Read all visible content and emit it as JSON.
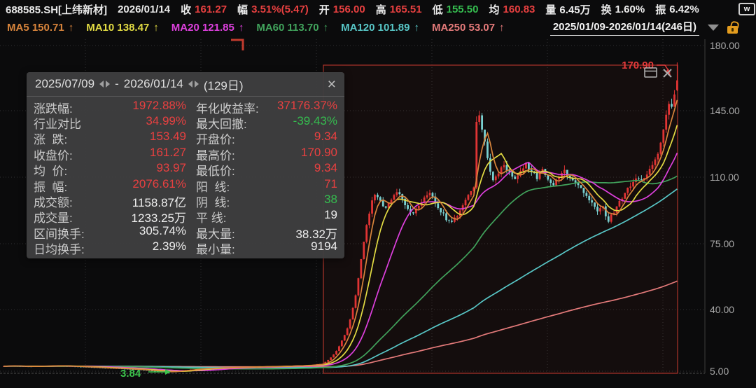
{
  "header": {
    "symbol": "688585.SH[上纬新材]",
    "date": "2026/01/14",
    "fields": [
      {
        "label": "收",
        "value": "161.27",
        "color": "red"
      },
      {
        "label": "幅",
        "value": "3.51%(5.47)",
        "color": "red"
      },
      {
        "label": "开",
        "value": "156.00",
        "color": "red"
      },
      {
        "label": "高",
        "value": "165.51",
        "color": "red"
      },
      {
        "label": "低",
        "value": "155.50",
        "color": "green"
      },
      {
        "label": "均",
        "value": "160.83",
        "color": "red"
      },
      {
        "label": "量",
        "value": "6.45万",
        "color": "white"
      },
      {
        "label": "换",
        "value": "1.60%",
        "color": "white"
      },
      {
        "label": "振",
        "value": "6.42%",
        "color": "white"
      }
    ],
    "corner_icon_label": "w"
  },
  "ma_bar": {
    "items": [
      {
        "label": "MA5",
        "value": "150.71",
        "arrow": "↑",
        "color": "#d9853c"
      },
      {
        "label": "MA10",
        "value": "138.47",
        "arrow": "↑",
        "color": "#e3dc43"
      },
      {
        "label": "MA20",
        "value": "121.85",
        "arrow": "↑",
        "color": "#de40de"
      },
      {
        "label": "MA60",
        "value": "113.70",
        "arrow": "↑",
        "color": "#41a35c"
      },
      {
        "label": "MA120",
        "value": "101.89",
        "arrow": "↑",
        "color": "#58c7c7"
      },
      {
        "label": "MA250",
        "value": "53.07",
        "arrow": "↑",
        "color": "#e47a7a"
      }
    ],
    "range": "2025/01/09-2026/01/14(246日)"
  },
  "stats_panel": {
    "start_date": "2025/07/09",
    "end_date": "2026/01/14",
    "days": "(129日)",
    "close_label": "×",
    "rows": [
      {
        "l_label": "涨跌幅:",
        "l_value": "1972.88%",
        "l_color": "red",
        "r_label": "年化收益率:",
        "r_value": "37176.37%",
        "r_color": "red"
      },
      {
        "l_label": "行业对比",
        "l_value": "34.99%",
        "l_color": "red",
        "r_label": "最大回撤:",
        "r_value": "-39.43%",
        "r_color": "green"
      },
      {
        "l_label": "涨  跌:",
        "l_value": "153.49",
        "l_color": "red",
        "r_label": "开盘价:",
        "r_value": "9.34",
        "r_color": "red"
      },
      {
        "l_label": "收盘价:",
        "l_value": "161.27",
        "l_color": "red",
        "r_label": "最高价:",
        "r_value": "170.90",
        "r_color": "red"
      },
      {
        "l_label": "均  价:",
        "l_value": "93.97",
        "l_color": "red",
        "r_label": "最低价:",
        "r_value": "9.34",
        "r_color": "red"
      },
      {
        "l_label": "振  幅:",
        "l_value": "2076.61%",
        "l_color": "red",
        "r_label": "阳  线:",
        "r_value": "71",
        "r_color": "red"
      },
      {
        "l_label": "成交额:",
        "l_value": "1158.87亿",
        "l_color": "white",
        "r_label": "阴  线:",
        "r_value": "38",
        "r_color": "green"
      },
      {
        "l_label": "成交量:",
        "l_value": "1233.25万",
        "l_color": "white",
        "r_label": "平 线:",
        "r_value": "19",
        "r_color": "white"
      },
      {
        "l_label": "区间换手:",
        "l_value": "305.74%",
        "l_color": "white",
        "r_label": "最大量:",
        "r_value": "38.32万",
        "r_color": "white"
      },
      {
        "l_label": "日均换手:",
        "l_value": "2.39%",
        "l_color": "white",
        "r_label": "最小量:",
        "r_value": "9194",
        "r_color": "white"
      }
    ]
  },
  "chart_data": {
    "type": "candlestick",
    "title": "688585.SH 上纬新材 daily K-line 2025/01/09 - 2026/01/14",
    "total_days": 246,
    "y_ticks": [
      "180.00",
      "145.00",
      "110.00",
      "75.00",
      "40.00",
      "5.00"
    ],
    "y_range": [
      5,
      180
    ],
    "high_marker": {
      "label": "170.90"
    },
    "low_marker": {
      "label": "3.84"
    },
    "selection": {
      "start_index": 117,
      "end_index": 245,
      "start_date": "2025/07/09",
      "end_date": "2026/01/14",
      "days": 129
    },
    "last_candle": {
      "open": 156.0,
      "high": 170.9,
      "low": 155.5,
      "close": 161.27
    },
    "low_candle_index": 60,
    "low_candle_low": 3.84,
    "ma_windows": [
      5,
      10,
      20,
      60,
      120,
      250
    ],
    "colors": {
      "up": "#e03434",
      "down": "#79d0d0",
      "selection": "#ac342a",
      "grid": "rgba(255,255,255,0.16)",
      "annotation_red": "#e23a3a",
      "annotation_green": "#3cc44c"
    },
    "series_anchors": [
      [
        0,
        7.8
      ],
      [
        10,
        7.6
      ],
      [
        20,
        7.9
      ],
      [
        30,
        7.3
      ],
      [
        40,
        6.6
      ],
      [
        50,
        5.8
      ],
      [
        56,
        5.0
      ],
      [
        60,
        4.6
      ],
      [
        64,
        5.2
      ],
      [
        72,
        6.4
      ],
      [
        82,
        7.0
      ],
      [
        92,
        7.4
      ],
      [
        102,
        7.7
      ],
      [
        110,
        8.1
      ],
      [
        116,
        9.0
      ],
      [
        117,
        10
      ],
      [
        118,
        11
      ],
      [
        119,
        12.5
      ],
      [
        120,
        14
      ],
      [
        121,
        16
      ],
      [
        122,
        18.5
      ],
      [
        123,
        21.5
      ],
      [
        124,
        24.5
      ],
      [
        125,
        28
      ],
      [
        126,
        33
      ],
      [
        127,
        39
      ],
      [
        128,
        46
      ],
      [
        129,
        55
      ],
      [
        130,
        65
      ],
      [
        131,
        75
      ],
      [
        132,
        83
      ],
      [
        133,
        90
      ],
      [
        134,
        96
      ],
      [
        135,
        100
      ],
      [
        137,
        96
      ],
      [
        139,
        93
      ],
      [
        141,
        98
      ],
      [
        143,
        102
      ],
      [
        145,
        97
      ],
      [
        147,
        92
      ],
      [
        149,
        89
      ],
      [
        151,
        94
      ],
      [
        153,
        99
      ],
      [
        155,
        101
      ],
      [
        157,
        96
      ],
      [
        159,
        91
      ],
      [
        161,
        87
      ],
      [
        163,
        85
      ],
      [
        165,
        89
      ],
      [
        167,
        94
      ],
      [
        169,
        99
      ],
      [
        171,
        103
      ],
      [
        172,
        140
      ],
      [
        173,
        142
      ],
      [
        174,
        136
      ],
      [
        175,
        128
      ],
      [
        176,
        119
      ],
      [
        177,
        112
      ],
      [
        178,
        107
      ],
      [
        180,
        112
      ],
      [
        182,
        116
      ],
      [
        184,
        111
      ],
      [
        186,
        108
      ],
      [
        188,
        112
      ],
      [
        190,
        116
      ],
      [
        192,
        112
      ],
      [
        194,
        109
      ],
      [
        196,
        113
      ],
      [
        198,
        109
      ],
      [
        200,
        105
      ],
      [
        202,
        109
      ],
      [
        204,
        113
      ],
      [
        206,
        109
      ],
      [
        208,
        106
      ],
      [
        210,
        103
      ],
      [
        212,
        99
      ],
      [
        214,
        95
      ],
      [
        216,
        91
      ],
      [
        218,
        93
      ],
      [
        219,
        88
      ],
      [
        220,
        86
      ],
      [
        222,
        91
      ],
      [
        224,
        96
      ],
      [
        226,
        101
      ],
      [
        228,
        105
      ],
      [
        230,
        109
      ],
      [
        232,
        107
      ],
      [
        234,
        111
      ],
      [
        236,
        115
      ],
      [
        237,
        119
      ],
      [
        238,
        123
      ],
      [
        239,
        129
      ],
      [
        240,
        136
      ],
      [
        241,
        143
      ],
      [
        242,
        150
      ],
      [
        243,
        146
      ],
      [
        244,
        154
      ],
      [
        245,
        161.27
      ]
    ]
  }
}
